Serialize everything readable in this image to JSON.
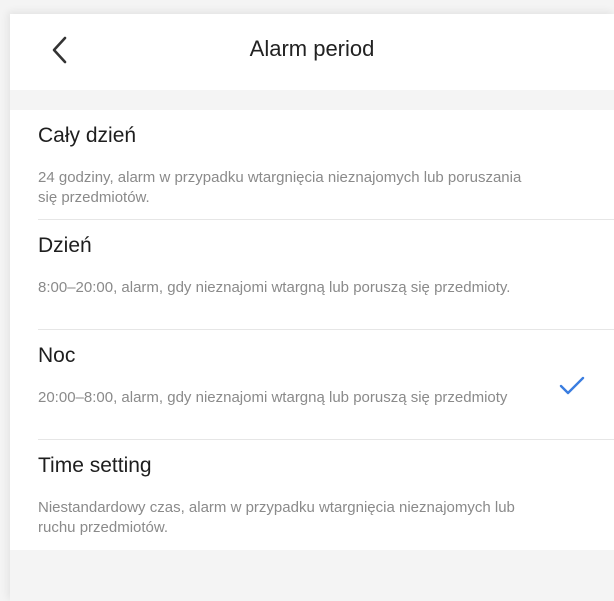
{
  "header": {
    "title": "Alarm period",
    "back_icon": "chevron-left-icon"
  },
  "options": [
    {
      "label": "Cały dzień",
      "description": "24 godziny, alarm w przypadku wtargnięcia nieznajomych lub poruszania się przedmiotów.",
      "selected": false
    },
    {
      "label": "Dzień",
      "description": "8:00–20:00, alarm, gdy nieznajomi wtargną lub poruszą się przedmioty.",
      "selected": false
    },
    {
      "label": "Noc",
      "description": "20:00–8:00, alarm, gdy nieznajomi wtargną lub poruszą się przedmioty",
      "selected": true
    },
    {
      "label": "Time setting",
      "description": "Niestandardowy czas, alarm w przypadku wtargnięcia nieznajomych lub ruchu przedmiotów.",
      "selected": false
    }
  ],
  "colors": {
    "accent": "#3a7de0",
    "background": "#f4f4f4"
  },
  "check_icon": "checkmark-icon"
}
